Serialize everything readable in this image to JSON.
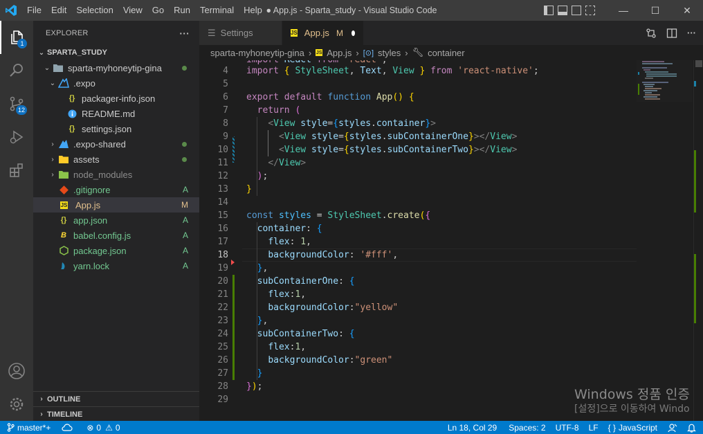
{
  "titlebar": {
    "menu": [
      "File",
      "Edit",
      "Selection",
      "View",
      "Go",
      "Run",
      "Terminal",
      "Help"
    ],
    "title": "● App.js - Sparta_study - Visual Studio Code",
    "minimize": "—",
    "maximize": "☐",
    "close": "✕"
  },
  "activity": {
    "explorer_badge": "1",
    "scm_badge": "12"
  },
  "sidebar": {
    "header": "EXPLORER",
    "more": "···",
    "workspace": "SPARTA_STUDY",
    "items": [
      {
        "label": "sparta-myhoneytip-gina",
        "status": ""
      },
      {
        "label": ".expo",
        "status": ""
      },
      {
        "label": "packager-info.json",
        "status": ""
      },
      {
        "label": "README.md",
        "status": ""
      },
      {
        "label": "settings.json",
        "status": ""
      },
      {
        "label": ".expo-shared",
        "status": ""
      },
      {
        "label": "assets",
        "status": ""
      },
      {
        "label": "node_modules",
        "status": ""
      },
      {
        "label": ".gitignore",
        "status": "A"
      },
      {
        "label": "App.js",
        "status": "M"
      },
      {
        "label": "app.json",
        "status": "A"
      },
      {
        "label": "babel.config.js",
        "status": "A"
      },
      {
        "label": "package.json",
        "status": "A"
      },
      {
        "label": "yarn.lock",
        "status": "A"
      }
    ],
    "outline": "OUTLINE",
    "timeline": "TIMELINE"
  },
  "tabs": [
    {
      "label": "Settings"
    },
    {
      "label": "App.js",
      "modified": "M"
    }
  ],
  "breadcrumb": [
    "sparta-myhoneytip-gina",
    "App.js",
    "styles",
    "container"
  ],
  "editor": {
    "line_numbers": [
      "4",
      "5",
      "6",
      "7",
      "8",
      "9",
      "10",
      "11",
      "12",
      "13",
      "14",
      "15",
      "16",
      "17",
      "18",
      "19",
      "20",
      "21",
      "22",
      "23",
      "24",
      "25",
      "26",
      "27",
      "28",
      "29"
    ],
    "current_line": "18"
  },
  "watermark": {
    "line1": "Windows 정품 인증",
    "line2": "[설정]으로 이동하여 Windo"
  },
  "statusbar": {
    "branch": "master*+",
    "errors": "0",
    "warnings": "0",
    "position": "Ln 18, Col 29",
    "spaces": "Spaces: 2",
    "encoding": "UTF-8",
    "eol": "LF",
    "language": "JavaScript"
  },
  "colors": {
    "accent": "#007acc",
    "modified": "#e2c08d",
    "added": "#73c991"
  }
}
